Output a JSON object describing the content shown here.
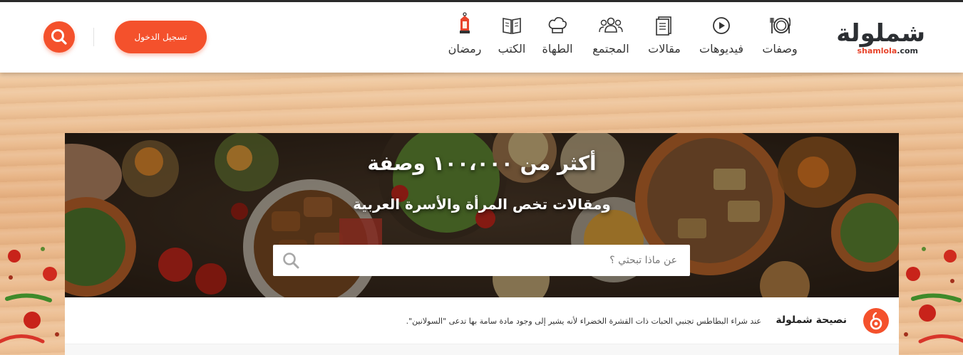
{
  "brand": {
    "logo_text": "شملولة",
    "domain_brand": "shamlola",
    "domain_tld": ".com",
    "accent_color": "#f4512c",
    "dark_color": "#2c2f33"
  },
  "nav": {
    "items": [
      {
        "label": "وصفات",
        "icon": "plate-fork-knife-icon"
      },
      {
        "label": "فيديوهات",
        "icon": "play-icon"
      },
      {
        "label": "مقالات",
        "icon": "document-icon"
      },
      {
        "label": "المجتمع",
        "icon": "people-icon"
      },
      {
        "label": "الطهاة",
        "icon": "chef-hat-icon"
      },
      {
        "label": "الكتب",
        "icon": "book-icon"
      },
      {
        "label": "رمضان",
        "icon": "lantern-icon"
      }
    ]
  },
  "header": {
    "login_label": "تسجيل الدخول",
    "search_icon": "search-icon"
  },
  "hero": {
    "title": "أكثر من ١٠٠،٠٠٠ وصفة",
    "subtitle": "ومقالات تخص المرأة والأسرة العربية",
    "search_placeholder": "عن ماذا تبحثي ؟"
  },
  "tip": {
    "label": "نصيحة شملولة",
    "text": "عند شراء البطاطس تجنبي الحبات ذات القشرة الخضراء لأنه يشير إلى وجود مادة سامة بها تدعى \"السولانين\"."
  }
}
